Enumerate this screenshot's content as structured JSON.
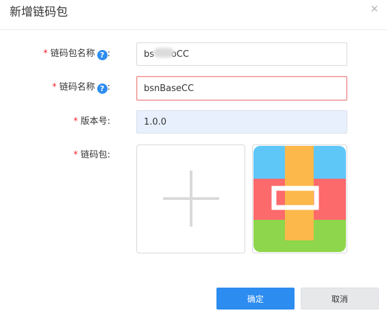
{
  "dialog": {
    "title": "新增链码包",
    "close_icon": "close-icon"
  },
  "form": {
    "package_name": {
      "required_mark": "*",
      "label": "链码包名称",
      "help": "?",
      "colon": ":",
      "value": "bs      oCC"
    },
    "chaincode_name": {
      "required_mark": "*",
      "label": "链码名称",
      "help": "?",
      "colon": ":",
      "value": "bsnBaseCC"
    },
    "version": {
      "required_mark": "*",
      "label": "版本号",
      "colon": ":",
      "value": "1.0.0"
    },
    "package": {
      "required_mark": "*",
      "label": "链码包",
      "colon": ":",
      "upload_icon": "plus-icon",
      "preview_icon": "archive-file-icon"
    }
  },
  "buttons": {
    "confirm": "确定",
    "cancel": "取消"
  },
  "colors": {
    "primary": "#2d8cf0",
    "required": "#f5222d",
    "error_border": "#f08a8a",
    "readonly_bg": "#e8f0fe"
  }
}
